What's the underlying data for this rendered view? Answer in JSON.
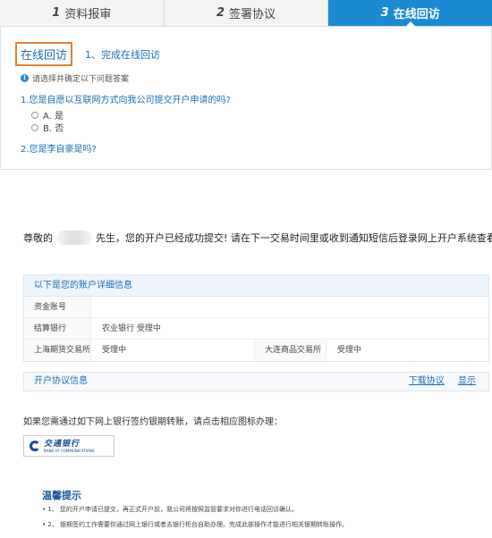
{
  "steps": [
    {
      "num": "1",
      "label": "资料报审"
    },
    {
      "num": "2",
      "label": "签署协议"
    },
    {
      "num": "3",
      "label": "在线回访"
    }
  ],
  "survey": {
    "tab_label": "在线回访",
    "step_link": "1、完成在线回访",
    "hint_icon": "info-icon",
    "hint": "请选择并确定以下问题答案",
    "question1": "1.您是自愿以互联网方式向我公司提交开户申请的吗?",
    "options": [
      "A. 是",
      "B. 否"
    ],
    "question2": "2.您是李自豪是吗?"
  },
  "greeting": {
    "prefix": "尊敬的",
    "suffix": "先生，您的开户已经成功提交! 请在下一交易时间里或收到通知短信后登录网上开户系统查看。"
  },
  "account": {
    "title": "以下是您的账户详细信息",
    "fund_account_label": "资金账号",
    "fund_account_value": "",
    "settle_bank_label": "结算银行",
    "settle_bank_value": "农业银行 受理中",
    "shfe_label": "上海期货交易所",
    "shfe_value": "受理中",
    "dce_label": "大连商品交易所",
    "dce_value": "受理中"
  },
  "agreement": {
    "title": "开户协议信息",
    "download": "下载协议",
    "show": "显示"
  },
  "bank": {
    "hint": "如果您需通过如下网上银行签约银期转账，请点击相应图标办理：",
    "logo_cn": "交通银行",
    "logo_en": "BANK OF COMMUNICATIONS",
    "accent": "#1b4b8a"
  },
  "tips": {
    "title": "温馨提示",
    "items": [
      "•  1、 您的开户申请已提交，再正式开户前，我公司将按照监管要求对你进行电话回访确认。",
      "•  2、 银期签约工作需要你通过网上银行或者去银行柜台自助办理。完成此部操作才能进行相关银期转账操作。"
    ]
  },
  "colors": {
    "active_step": "#1b8ad3",
    "link": "#1b6fb3",
    "highlight_border": "#e8822a"
  }
}
